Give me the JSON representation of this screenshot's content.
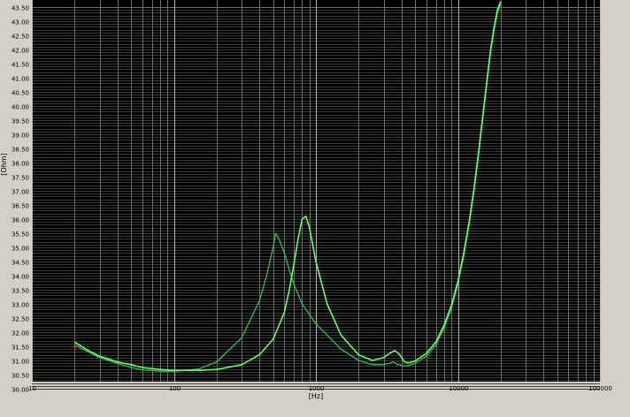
{
  "chart_data": {
    "type": "line",
    "title": "",
    "xlabel": "[Hz]",
    "ylabel": "[Ohm]",
    "x_scale": "log",
    "xlim": [
      10,
      100000
    ],
    "ylim": [
      30.0,
      43.5
    ],
    "grid": true,
    "x_tick_labels": [
      "10",
      "100",
      "1000",
      "10000",
      "100000"
    ],
    "x_tick_values": [
      10,
      100,
      1000,
      10000,
      100000
    ],
    "y_tick_labels": [
      "30.00",
      "30.50",
      "31.00",
      "31.50",
      "32.00",
      "32.50",
      "33.00",
      "33.50",
      "34.00",
      "34.50",
      "35.00",
      "35.50",
      "36.00",
      "36.50",
      "37.00",
      "37.50",
      "38.00",
      "38.50",
      "39.00",
      "39.50",
      "40.00",
      "40.50",
      "41.00",
      "41.50",
      "42.00",
      "42.50",
      "43.00",
      "43.50"
    ],
    "y_tick_values": [
      30.0,
      30.5,
      31.0,
      31.5,
      32.0,
      32.5,
      33.0,
      33.5,
      34.0,
      34.5,
      35.0,
      35.5,
      36.0,
      36.5,
      37.0,
      37.5,
      38.0,
      38.5,
      39.0,
      39.5,
      40.0,
      40.5,
      41.0,
      41.5,
      42.0,
      42.5,
      43.0,
      43.5
    ],
    "colors": {
      "background": "#000000",
      "grid_major": "#b4b4b4",
      "grid_minor": "#6e6e6e",
      "frame": "#d4d0c8"
    },
    "series": [
      {
        "color": "#2fbf55",
        "x": [
          20,
          25,
          30,
          40,
          50,
          60,
          80,
          100,
          150,
          200,
          300,
          400,
          450,
          500,
          520,
          550,
          600,
          650,
          700,
          800,
          1000,
          1500,
          2000,
          2500,
          3000,
          3300,
          3500,
          3800,
          4200,
          4500,
          5000,
          6000,
          7000,
          8000,
          9000,
          10000,
          11000,
          12000,
          13000,
          14000,
          15000,
          16000,
          17000,
          18000,
          19000,
          20000
        ],
        "y": [
          31.55,
          31.3,
          31.1,
          30.9,
          30.75,
          30.67,
          30.62,
          30.62,
          30.7,
          30.95,
          31.8,
          33.1,
          34.0,
          35.0,
          35.5,
          35.3,
          34.8,
          34.2,
          33.7,
          33.0,
          32.3,
          31.4,
          31.0,
          30.85,
          30.85,
          30.9,
          30.95,
          30.85,
          30.8,
          30.82,
          30.9,
          31.15,
          31.55,
          32.15,
          32.85,
          33.7,
          34.7,
          35.8,
          37.0,
          38.3,
          39.6,
          40.8,
          41.9,
          42.7,
          43.3,
          43.6
        ]
      },
      {
        "color": "#66ff66",
        "x": [
          20,
          25,
          30,
          40,
          50,
          60,
          80,
          100,
          150,
          200,
          300,
          400,
          500,
          600,
          650,
          700,
          750,
          800,
          850,
          900,
          1000,
          1200,
          1500,
          2000,
          2500,
          3000,
          3300,
          3600,
          3900,
          4200,
          4500,
          5000,
          6000,
          7000,
          8000,
          9000,
          10000,
          11000,
          12000,
          13000,
          14000,
          15000,
          16000,
          17000,
          18000,
          19000,
          20000
        ],
        "y": [
          31.65,
          31.35,
          31.15,
          30.95,
          30.85,
          30.75,
          30.68,
          30.65,
          30.65,
          30.68,
          30.85,
          31.2,
          31.75,
          32.7,
          33.5,
          34.4,
          35.3,
          36.0,
          36.1,
          35.7,
          34.5,
          33.0,
          31.9,
          31.2,
          31.0,
          31.1,
          31.25,
          31.35,
          31.2,
          30.95,
          30.92,
          30.98,
          31.25,
          31.65,
          32.25,
          32.95,
          33.8,
          34.8,
          35.9,
          37.1,
          38.4,
          39.7,
          40.9,
          42.0,
          42.8,
          43.4,
          43.7
        ]
      }
    ]
  }
}
